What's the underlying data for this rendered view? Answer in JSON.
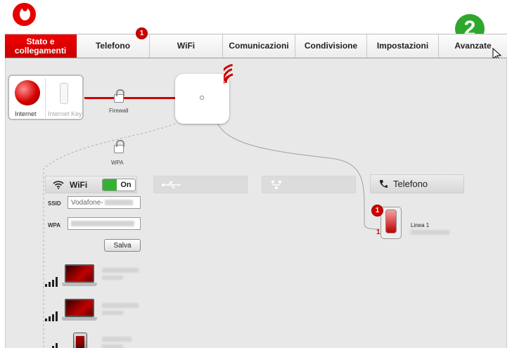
{
  "nav": {
    "tabs": [
      {
        "label_1": "Stato e",
        "label_2": "collegamenti",
        "active": true
      },
      {
        "label": "Telefono",
        "badge": "1"
      },
      {
        "label": "WiFi"
      },
      {
        "label": "Comunicazioni"
      },
      {
        "label": "Condivisione"
      },
      {
        "label": "Impostazioni"
      },
      {
        "label": "Avanzate"
      }
    ]
  },
  "step_badge": "2",
  "network": {
    "internet_label": "Internet",
    "internet_key_label": "Internet Key",
    "firewall_label": "Firewall",
    "wpa_label": "WPA"
  },
  "wifi": {
    "title": "WiFi",
    "toggle": "On",
    "ssid_label": "SSID",
    "ssid_value": "Vodafone-",
    "wpa_label": "WPA",
    "save_label": "Salva"
  },
  "telefono": {
    "title": "Telefono",
    "badge": "1",
    "line_number": "1",
    "line_label": "Linea 1"
  },
  "colors": {
    "accent_red": "#e60000",
    "step_green": "#2da82d",
    "toggle_green": "#35b035"
  }
}
